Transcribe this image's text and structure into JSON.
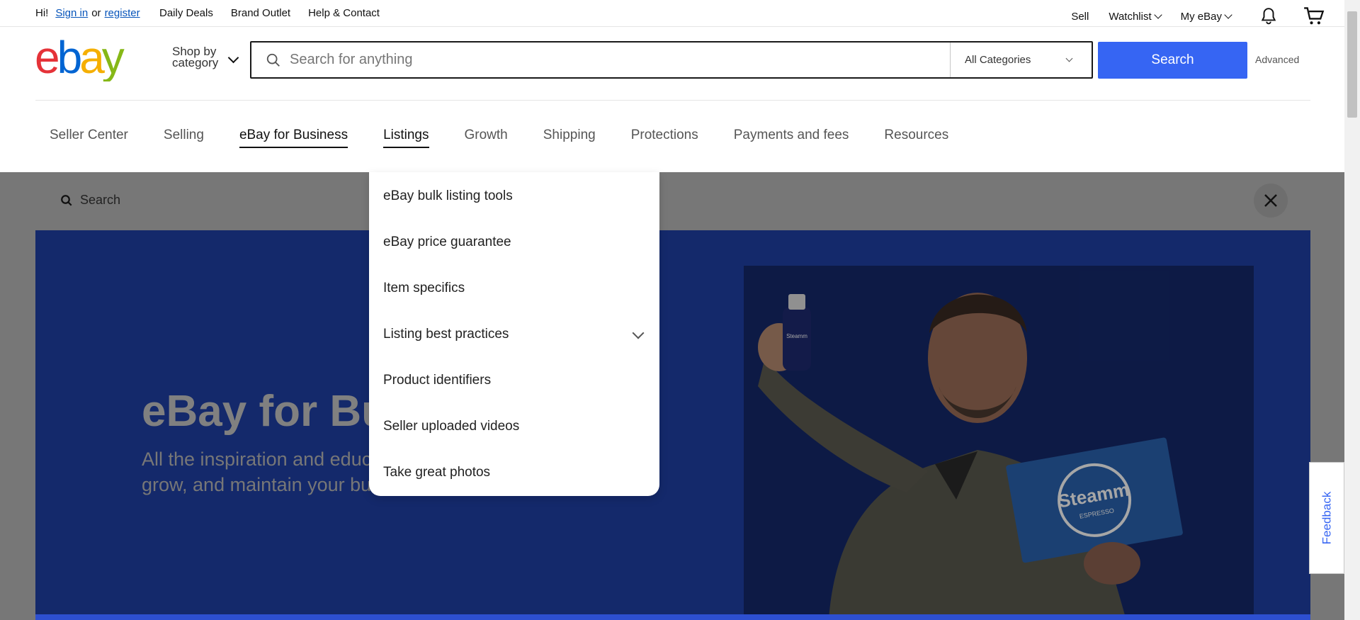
{
  "topbar": {
    "greeting": "Hi!",
    "sign_in": "Sign in",
    "or": "or",
    "register": "register",
    "links": [
      "Daily Deals",
      "Brand Outlet",
      "Help & Contact"
    ],
    "sell": "Sell",
    "watchlist": "Watchlist",
    "my_ebay": "My eBay"
  },
  "header": {
    "logo_letters": [
      "e",
      "b",
      "a",
      "y"
    ],
    "logo_colors": [
      "#e53238",
      "#0064d2",
      "#f5af02",
      "#86b817"
    ],
    "shop_by_line1": "Shop by",
    "shop_by_line2": "category",
    "search_placeholder": "Search for anything",
    "category_selected": "All Categories",
    "search_button": "Search",
    "advanced": "Advanced"
  },
  "nav": {
    "items": [
      "Seller Center",
      "Selling",
      "eBay for Business",
      "Listings",
      "Growth",
      "Shipping",
      "Protections",
      "Payments and fees",
      "Resources"
    ]
  },
  "overlay": {
    "search_label": "Search"
  },
  "hero": {
    "title": "eBay for Bus",
    "subtitle_line1": "All the inspiration and educ",
    "subtitle_line2": "grow, and maintain your bu",
    "bottle_label": "Steamm",
    "box_label": "Steamm",
    "box_sub": "ESPRESSO"
  },
  "dropdown": {
    "items": [
      "eBay bulk listing tools",
      "eBay price guarantee",
      "Item specifics",
      "Listing best practices",
      "Product identifiers",
      "Seller uploaded videos",
      "Take great photos"
    ]
  },
  "feedback": "Feedback"
}
